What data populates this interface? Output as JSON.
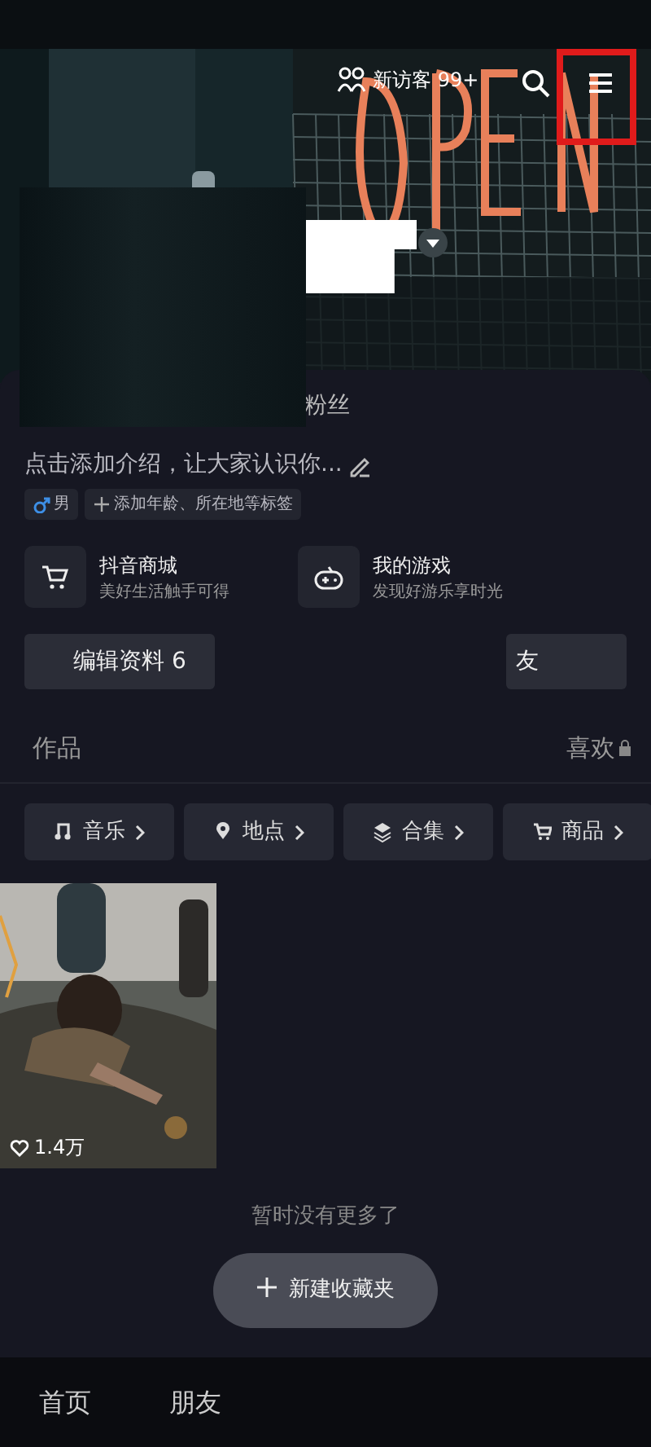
{
  "top_bar": {
    "visitors": "新访客 99+"
  },
  "profile": {
    "fans_label": "粉丝",
    "bio": "点击添加介绍，让大家认识你...",
    "tags": [
      {
        "kind": "gender",
        "label": "男"
      },
      {
        "kind": "add",
        "label": "添加年龄、所在地等标签"
      }
    ]
  },
  "shortcuts": [
    {
      "kind": "shop",
      "title": "抖音商城",
      "subtitle": "美好生活触手可得"
    },
    {
      "kind": "game",
      "title": "我的游戏",
      "subtitle": "发现好游乐享时光"
    }
  ],
  "buttons": [
    "编辑资料 6",
    "友"
  ],
  "tabs": [
    {
      "label": "作品",
      "locked": false
    },
    {
      "label": "喜欢",
      "locked": true
    }
  ],
  "chips": [
    {
      "kind": "music",
      "label": "音乐"
    },
    {
      "kind": "place",
      "label": "地点"
    },
    {
      "kind": "collection",
      "label": "合集"
    },
    {
      "kind": "goods",
      "label": "商品"
    }
  ],
  "videos": [
    {
      "kind": "picture",
      "likes": "1.4万"
    }
  ],
  "end_text": "暂时没有更多了",
  "new_folder_button": "新建收藏夹",
  "bottom_nav": [
    "首页",
    "朋友"
  ]
}
